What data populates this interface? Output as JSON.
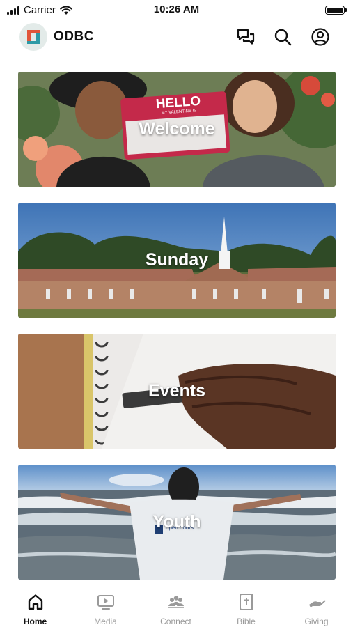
{
  "status_bar": {
    "carrier": "Carrier",
    "time": "10:26 AM"
  },
  "header": {
    "title": "ODBC",
    "icons": [
      "chat-icon",
      "search-icon",
      "account-icon"
    ]
  },
  "cards": [
    {
      "label": "Welcome",
      "sign_top": "HELLO",
      "sign_sub": "MY VALENTINE IS"
    },
    {
      "label": "Sunday"
    },
    {
      "label": "Events"
    },
    {
      "label": "Youth",
      "shirt_text": "open doors"
    }
  ],
  "tabs": [
    {
      "label": "Home",
      "icon": "home-icon",
      "active": true
    },
    {
      "label": "Media",
      "icon": "media-icon",
      "active": false
    },
    {
      "label": "Connect",
      "icon": "connect-icon",
      "active": false
    },
    {
      "label": "Bible",
      "icon": "bible-icon",
      "active": false
    },
    {
      "label": "Giving",
      "icon": "giving-icon",
      "active": false
    }
  ],
  "colors": {
    "active_tab": "#111111",
    "inactive_tab": "#9a9a9a",
    "sign_red": "#c4294a",
    "sky": "#4f86c6"
  }
}
